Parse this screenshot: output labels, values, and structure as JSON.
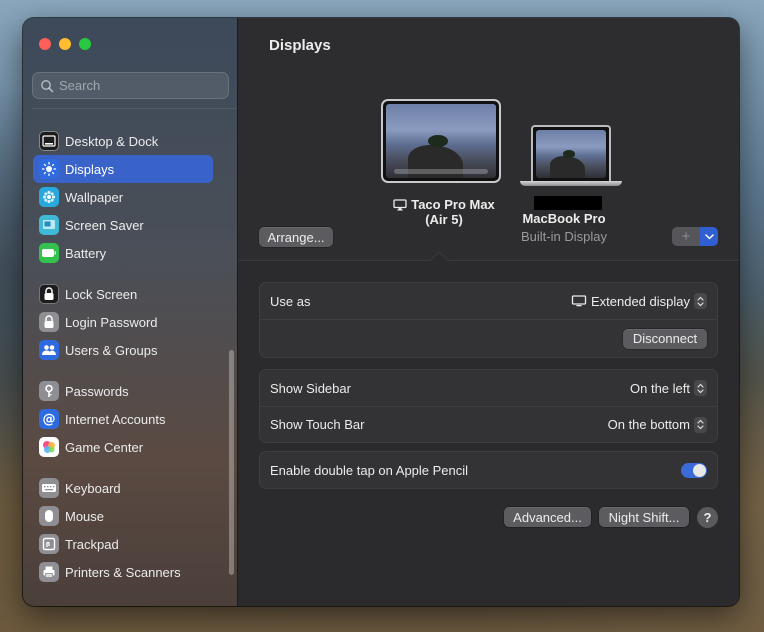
{
  "sidebar": {
    "search_placeholder": "Search",
    "items": [
      {
        "label": "Desktop & Dock",
        "icon": "desktop-dock-icon",
        "color": "#1c1c1e"
      },
      {
        "label": "Displays",
        "icon": "displays-icon",
        "color": "#2f6be0",
        "active": true
      },
      {
        "label": "Wallpaper",
        "icon": "wallpaper-icon",
        "color": "#29a8dd"
      },
      {
        "label": "Screen Saver",
        "icon": "screen-saver-icon",
        "color": "#3fb9d6"
      },
      {
        "label": "Battery",
        "icon": "battery-icon",
        "color": "#33c24d"
      },
      {
        "label": "Lock Screen",
        "icon": "lock-screen-icon",
        "color": "#1c1c1e"
      },
      {
        "label": "Login Password",
        "icon": "login-password-icon",
        "color": "#8e8e93"
      },
      {
        "label": "Users & Groups",
        "icon": "users-groups-icon",
        "color": "#2f6be0"
      },
      {
        "label": "Passwords",
        "icon": "passwords-icon",
        "color": "#8e8e93"
      },
      {
        "label": "Internet Accounts",
        "icon": "internet-accounts-icon",
        "color": "#2f6be0"
      },
      {
        "label": "Game Center",
        "icon": "game-center-icon",
        "color": "#ffffff"
      },
      {
        "label": "Keyboard",
        "icon": "keyboard-icon",
        "color": "#8e8e93"
      },
      {
        "label": "Mouse",
        "icon": "mouse-icon",
        "color": "#8e8e93"
      },
      {
        "label": "Trackpad",
        "icon": "trackpad-icon",
        "color": "#8e8e93"
      },
      {
        "label": "Printers & Scanners",
        "icon": "printers-scanners-icon",
        "color": "#8e8e93"
      }
    ]
  },
  "main": {
    "title": "Displays",
    "arrange_label": "Arrange...",
    "ipad_name_line1": "Taco Pro Max",
    "ipad_name_line2": "(Air 5)",
    "mac_name": "MacBook Pro",
    "mac_sub": "Built-in Display",
    "add_label": "+",
    "use_as_label": "Use as",
    "use_as_value": "Extended display",
    "disconnect_label": "Disconnect",
    "sidebar_label": "Show Sidebar",
    "sidebar_value": "On the left",
    "touchbar_label": "Show Touch Bar",
    "touchbar_value": "On the bottom",
    "pencil_label": "Enable double tap on Apple Pencil",
    "advanced_label": "Advanced...",
    "nightshift_label": "Night Shift...",
    "help_label": "?"
  },
  "colors": {
    "accent": "#3a63c9",
    "toggle_on": "#3a6bd8"
  }
}
